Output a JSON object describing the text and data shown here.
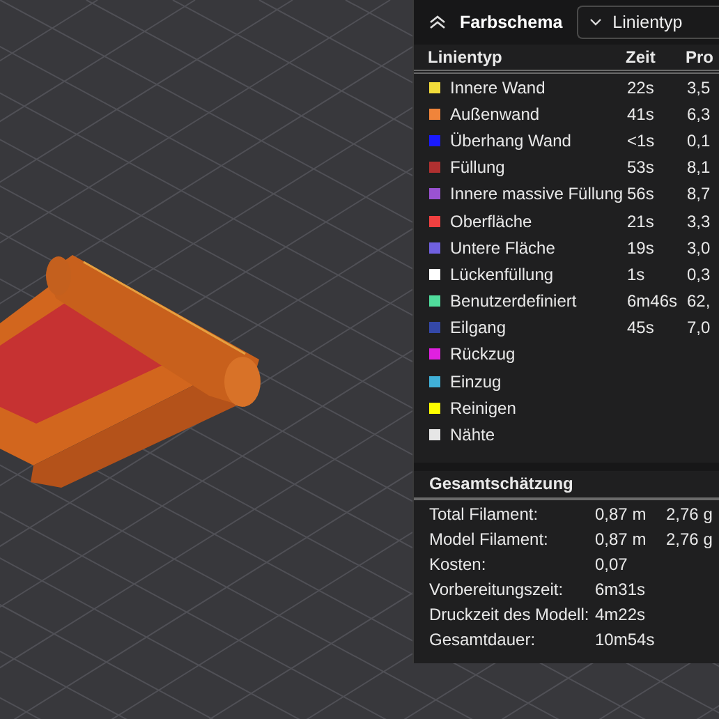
{
  "header": {
    "title": "Farbschema",
    "dropdown": {
      "value": "Linientyp"
    }
  },
  "table": {
    "columns": [
      "Linientyp",
      "Zeit",
      "Pro"
    ],
    "rows": [
      {
        "name": "Innere Wand",
        "color": "#f2dc3a",
        "time": "22s",
        "percent": "3,5"
      },
      {
        "name": "Außenwand",
        "color": "#f0843a",
        "time": "41s",
        "percent": "6,3"
      },
      {
        "name": "Überhang Wand",
        "color": "#1a1aff",
        "time": "<1s",
        "percent": "0,1"
      },
      {
        "name": "Füllung",
        "color": "#b03030",
        "time": "53s",
        "percent": "8,1"
      },
      {
        "name": "Innere massive Füllung",
        "color": "#9a52d2",
        "time": "56s",
        "percent": "8,7"
      },
      {
        "name": "Oberfläche",
        "color": "#f04040",
        "time": "21s",
        "percent": "3,3"
      },
      {
        "name": "Untere Fläche",
        "color": "#7060e0",
        "time": "19s",
        "percent": "3,0"
      },
      {
        "name": "Lückenfüllung",
        "color": "#ffffff",
        "time": "1s",
        "percent": "0,3"
      },
      {
        "name": "Benutzerdefiniert",
        "color": "#50dc9c",
        "time": "6m46s",
        "percent": "62,"
      },
      {
        "name": "Eilgang",
        "color": "#3448a8",
        "time": "45s",
        "percent": "7,0"
      },
      {
        "name": "Rückzug",
        "color": "#e020e0"
      },
      {
        "name": "Einzug",
        "color": "#40b0d8"
      },
      {
        "name": "Reinigen",
        "color": "#ffff00"
      },
      {
        "name": "Nähte",
        "color": "#e6e6e6"
      }
    ]
  },
  "summary": {
    "title": "Gesamtschätzung",
    "rows": [
      {
        "label": "Total Filament:",
        "values": [
          "0,87 m",
          "2,76 g"
        ]
      },
      {
        "label": "Model Filament:",
        "values": [
          "0,87 m",
          "2,76 g"
        ]
      },
      {
        "label": "Kosten:",
        "values": [
          "0,07"
        ]
      },
      {
        "label": "Vorbereitungszeit:",
        "values": [
          "6m31s"
        ]
      },
      {
        "label": "Druckzeit des Modell:",
        "values": [
          "4m22s"
        ]
      },
      {
        "label": "Gesamtdauer:",
        "values": [
          "10m54s"
        ]
      }
    ]
  }
}
